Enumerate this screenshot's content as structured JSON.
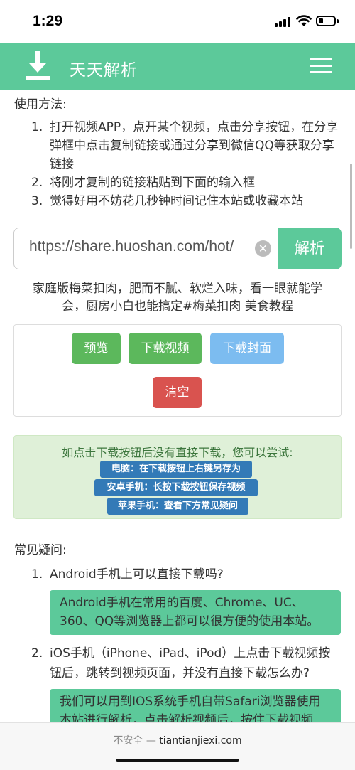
{
  "status_bar": {
    "time": "1:29"
  },
  "header": {
    "title": "天天解析",
    "brand_color": "#5cc99a"
  },
  "usage": {
    "title": "使用方法:",
    "steps": [
      {
        "num": "1.",
        "text": "打开视频APP，点开某个视频，点击分享按钮，在分享弹框中点击复制链接或通过分享到微信QQ等获取分享链接"
      },
      {
        "num": "2.",
        "text": "将刚才复制的链接粘贴到下面的输入框"
      },
      {
        "num": "3.",
        "text": "觉得好用不妨花几秒钟时间记住本站或收藏本站"
      }
    ]
  },
  "parser": {
    "url_value": "https://share.huoshan.com/hot/",
    "parse_label": "解析"
  },
  "video": {
    "title": "家庭版梅菜扣肉，肥而不腻、软烂入味，看一眼就能学会，厨房小白也能搞定#梅菜扣肉 美食教程"
  },
  "actions": {
    "preview": "预览",
    "download_video": "下载视频",
    "download_cover": "下载封面",
    "clear": "清空"
  },
  "tip": {
    "title": "如点击下载按钮后没有直接下载，您可以尝试:",
    "pc": "电脑：在下载按钮上右键另存为",
    "android": "安卓手机：长按下载按钮保存视频",
    "apple": "苹果手机：查看下方常见疑问"
  },
  "faq": {
    "title": "常见疑问:",
    "items": [
      {
        "num": "1.",
        "question": "Android手机上可以直接下载吗?",
        "answer": "Android手机在常用的百度、Chrome、UC、360、QQ等浏览器上都可以很方便的使用本站。"
      },
      {
        "num": "2.",
        "question": "iOS手机（iPhone、iPad、iPod）上点击下载视频按钮后，跳转到视频页面，并没有直接下载怎么办?",
        "answer": "我们可以用到IOS系统手机自带Safari浏览器使用本站进行解析，点击解析视频后，按住下载视频"
      }
    ]
  },
  "browser": {
    "insecure": "不安全 —",
    "domain": "tiantianjiexi.com"
  }
}
